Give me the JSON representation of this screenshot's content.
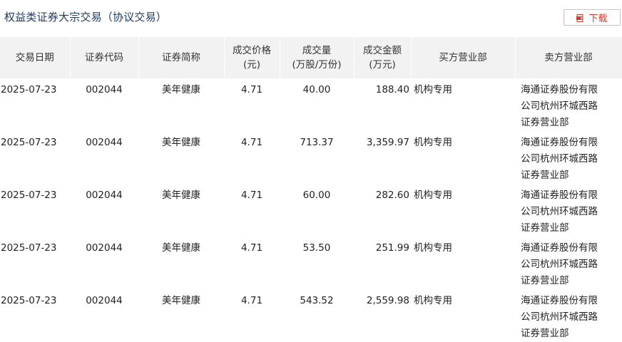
{
  "header": {
    "title": "权益类证券大宗交易（协议交易）",
    "download_label": "下载",
    "accent_color": "#d23a2d"
  },
  "table": {
    "columns": [
      {
        "key": "date",
        "label": "交易日期"
      },
      {
        "key": "code",
        "label": "证券代码"
      },
      {
        "key": "name",
        "label": "证券简称"
      },
      {
        "key": "price",
        "label": "成交价格\n(元)"
      },
      {
        "key": "volume",
        "label": "成交量\n(万股/万份)"
      },
      {
        "key": "amount",
        "label": "成交金额\n(万元)"
      },
      {
        "key": "buyer",
        "label": "买方营业部"
      },
      {
        "key": "seller",
        "label": "卖方营业部"
      }
    ],
    "rows": [
      {
        "date": "2025-07-23",
        "code": "002044",
        "name": "美年健康",
        "price": "4.71",
        "volume": "40.00",
        "amount": "188.40",
        "buyer": "机构专用",
        "seller": "海通证券股份有限公司杭州环城西路证券营业部"
      },
      {
        "date": "2025-07-23",
        "code": "002044",
        "name": "美年健康",
        "price": "4.71",
        "volume": "713.37",
        "amount": "3,359.97",
        "buyer": "机构专用",
        "seller": "海通证券股份有限公司杭州环城西路证券营业部"
      },
      {
        "date": "2025-07-23",
        "code": "002044",
        "name": "美年健康",
        "price": "4.71",
        "volume": "60.00",
        "amount": "282.60",
        "buyer": "机构专用",
        "seller": "海通证券股份有限公司杭州环城西路证券营业部"
      },
      {
        "date": "2025-07-23",
        "code": "002044",
        "name": "美年健康",
        "price": "4.71",
        "volume": "53.50",
        "amount": "251.99",
        "buyer": "机构专用",
        "seller": "海通证券股份有限公司杭州环城西路证券营业部"
      },
      {
        "date": "2025-07-23",
        "code": "002044",
        "name": "美年健康",
        "price": "4.71",
        "volume": "543.52",
        "amount": "2,559.98",
        "buyer": "机构专用",
        "seller": "海通证券股份有限公司杭州环城西路证券营业部"
      }
    ]
  }
}
